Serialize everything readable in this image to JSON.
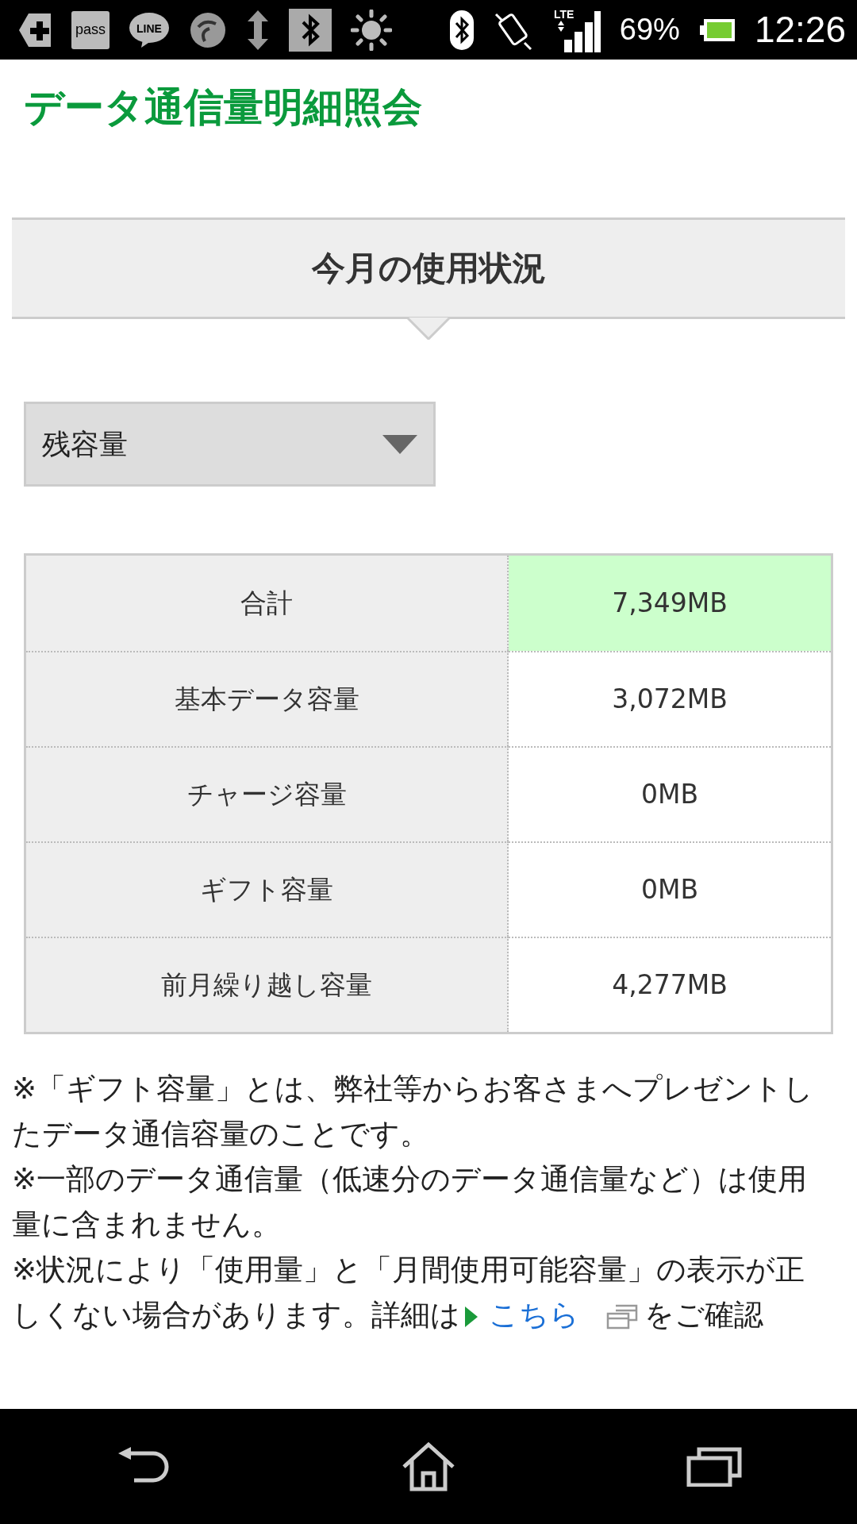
{
  "status_bar": {
    "app_labels": [
      "pass",
      "LINE"
    ],
    "network": "LTE",
    "battery_percent": "69%",
    "time": "12:26"
  },
  "page_title": "データ通信量明細照会",
  "section_title": "今月の使用状況",
  "dropdown": {
    "value": "残容量"
  },
  "table": {
    "rows": [
      {
        "label": "合計",
        "value": "7,349MB",
        "highlighted": true
      },
      {
        "label": "基本データ容量",
        "value": "3,072MB",
        "highlighted": false
      },
      {
        "label": "チャージ容量",
        "value": "0MB",
        "highlighted": false
      },
      {
        "label": "ギフト容量",
        "value": "0MB",
        "highlighted": false
      },
      {
        "label": "前月繰り越し容量",
        "value": "4,277MB",
        "highlighted": false
      }
    ]
  },
  "notes": [
    {
      "text": "※「ギフト容量」とは、弊社等からお客さまへプレゼントしたデータ通信容量のことです。"
    },
    {
      "text": "※一部のデータ通信量（低速分のデータ通信量など）は使用量に含まれません。"
    },
    {
      "text": "※状況により「使用量」と「月間使用可能容量」の表示が正しくない場合があります。詳細は",
      "link": "こちら",
      "after": "をご確認"
    }
  ]
}
